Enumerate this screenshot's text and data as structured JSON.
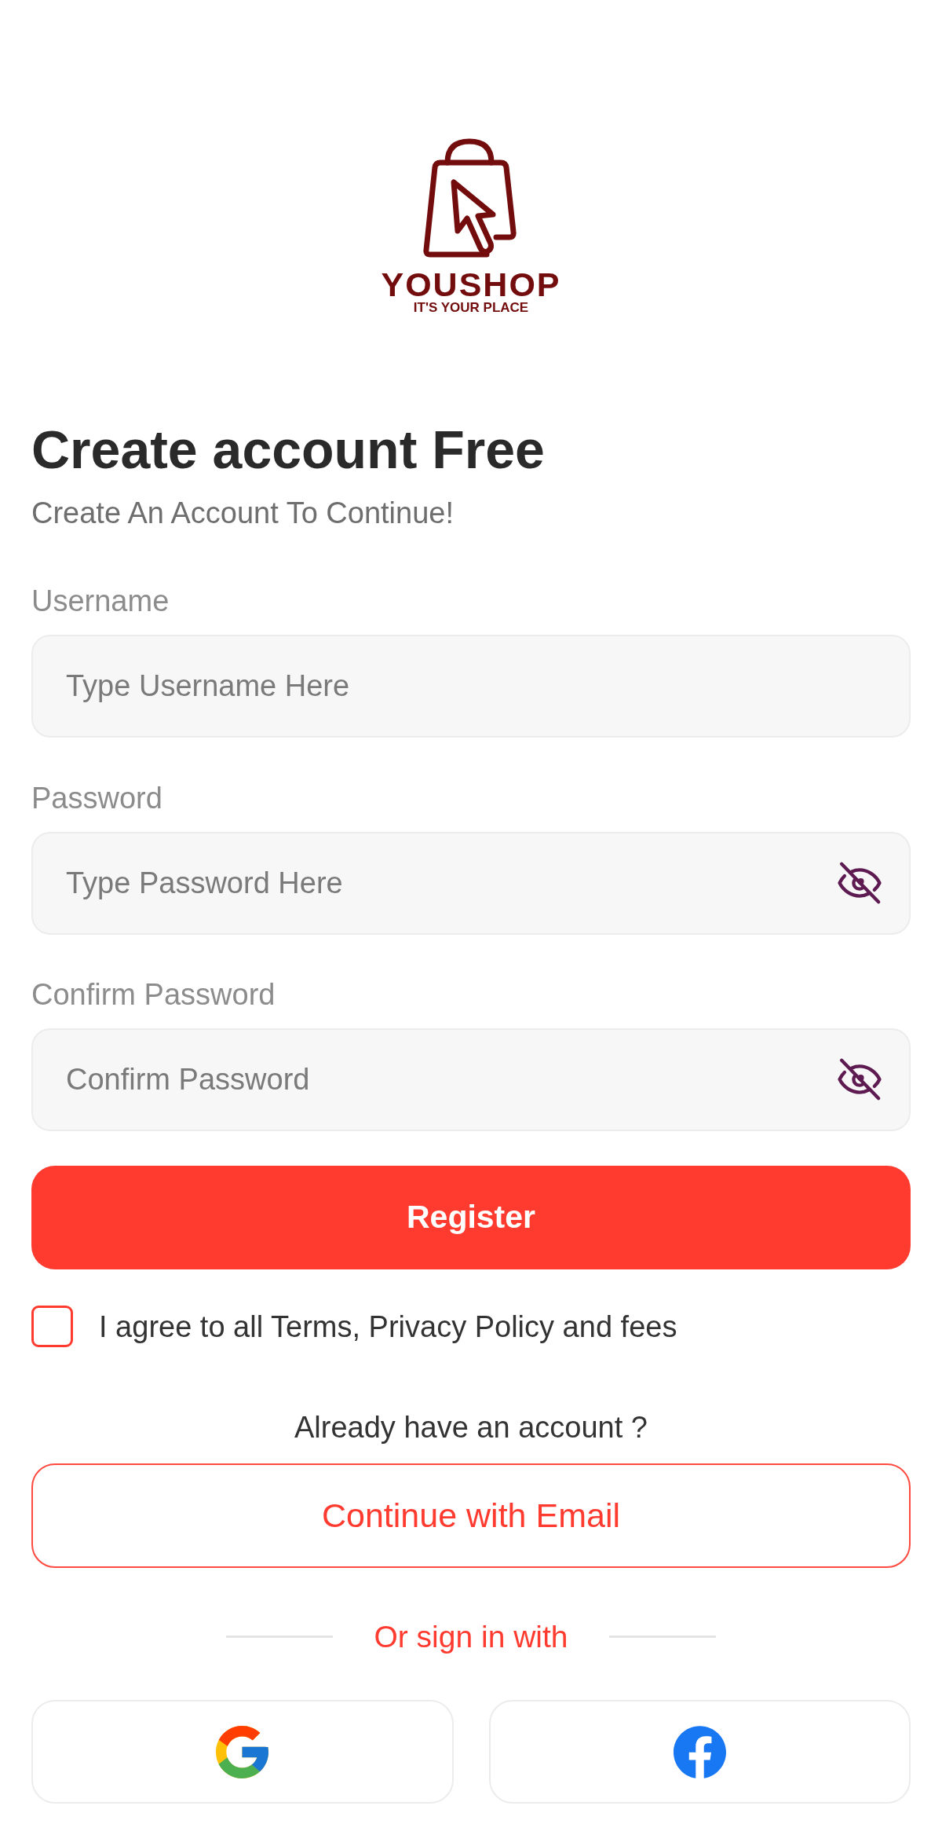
{
  "logo": {
    "name": "YOUSHOP",
    "tagline": "IT'S YOUR PLACE"
  },
  "heading": "Create account Free",
  "subtitle": "Create An Account To Continue!",
  "fields": [
    {
      "label": "Username",
      "placeholder": "Type Username Here",
      "kind": "text"
    },
    {
      "label": "Password",
      "placeholder": "Type Password Here",
      "kind": "password"
    },
    {
      "label": "Confirm Password",
      "placeholder": "Confirm Password",
      "kind": "password"
    }
  ],
  "register_button": "Register",
  "terms": {
    "label": "I agree to all Terms, Privacy Policy and fees",
    "checked": false
  },
  "login_prompt": "Already have an account ?",
  "email_button": "Continue with Email",
  "divider": "Or sign in with",
  "social_buttons": [
    {
      "kind": "google"
    },
    {
      "kind": "facebook"
    }
  ]
}
